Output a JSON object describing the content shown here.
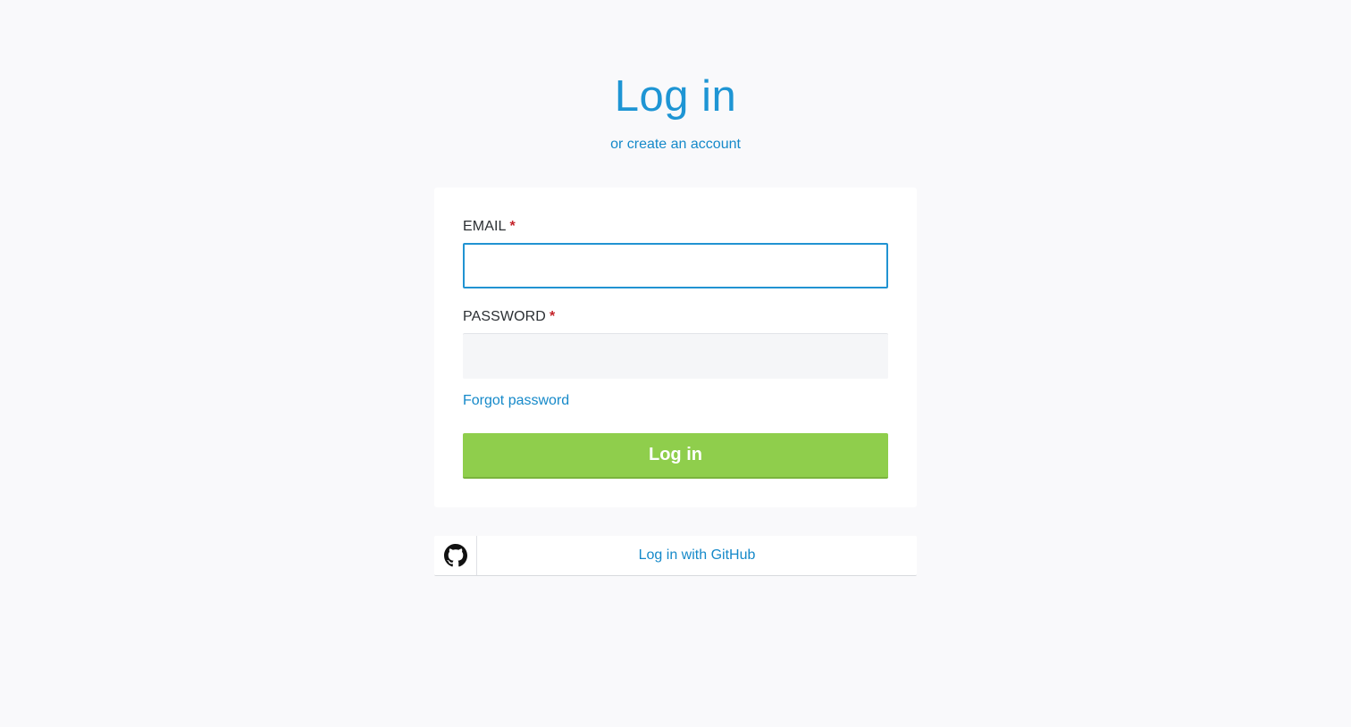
{
  "header": {
    "title": "Log in",
    "create_account_link": "or create an account"
  },
  "form": {
    "email": {
      "label": "EMAIL",
      "required_mark": "*",
      "value": "",
      "placeholder": ""
    },
    "password": {
      "label": "PASSWORD",
      "required_mark": "*",
      "value": "",
      "placeholder": ""
    },
    "forgot_password_link": "Forgot password",
    "submit_label": "Log in"
  },
  "github": {
    "icon": "github-icon",
    "label": "Log in with GitHub"
  },
  "colors": {
    "accent": "#1e95d4",
    "link": "#1589c9",
    "primary_button": "#8fce4c",
    "required": "#c4232a",
    "background": "#f9f9fb"
  }
}
